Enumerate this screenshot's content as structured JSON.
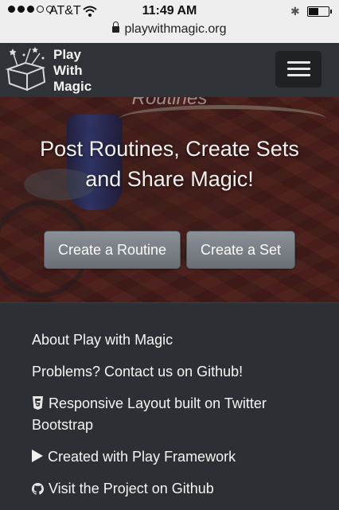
{
  "status_bar": {
    "carrier": "AT&T",
    "time": "11:49 AM",
    "url": "playwithmagic.org",
    "signal_bars": 3,
    "signal_total": 5,
    "battery_level": 0.5
  },
  "navbar": {
    "brand_lines": [
      "Play",
      "With",
      "Magic"
    ]
  },
  "hero": {
    "partial_heading": "Routines",
    "title_line1": "Post Routines, Create Sets",
    "title_line2": "and Share Magic!",
    "btn_routine": "Create a Routine",
    "btn_set": "Create a Set"
  },
  "footer": {
    "about": "About Play with Magic",
    "problems": "Problems? Contact us on Github!",
    "responsive": "Responsive Layout built on Twitter Bootstrap",
    "play": "Created with Play Framework",
    "github": "Visit the Project on Github"
  },
  "colors": {
    "navbar_bg": "#2f3337",
    "footer_bg": "#2c3034",
    "button_bg": "#7b8187"
  },
  "icons": [
    "wifi-icon",
    "bluetooth-icon",
    "battery-icon",
    "lock-icon",
    "menu-icon",
    "css3-icon",
    "play-icon",
    "github-icon"
  ]
}
